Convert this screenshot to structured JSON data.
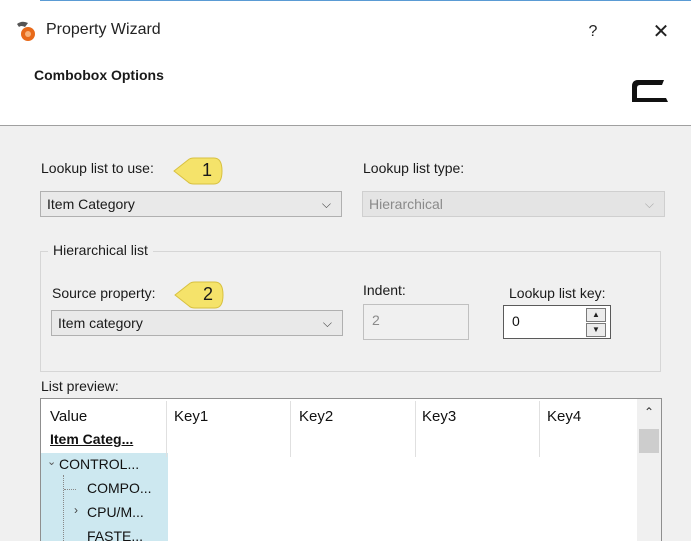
{
  "window": {
    "title": "Property Wizard",
    "help_label": "?",
    "close_label": "✕"
  },
  "header": {
    "section_title": "Combobox Options"
  },
  "lookup": {
    "list_label": "Lookup list to use:",
    "list_value": "Item Category",
    "type_label": "Lookup list type:",
    "type_value": "Hierarchical"
  },
  "callouts": [
    "1",
    "2"
  ],
  "hierarchical": {
    "group_label": "Hierarchical list",
    "source_label": "Source property:",
    "source_value": "Item category",
    "indent_label": "Indent:",
    "indent_value": "2",
    "key_label": "Lookup list key:",
    "key_value": "0"
  },
  "preview": {
    "label": "List preview:",
    "columns": [
      "Value",
      "Key1",
      "Key2",
      "Key3",
      "Key4"
    ],
    "rows": [
      "Item Categ...",
      "CONTROL...",
      "COMPO...",
      "CPU/M...",
      "FASTE..."
    ]
  },
  "colors": {
    "callout_fill": "#f5e36a",
    "selection": "#cde8f0",
    "brand_accent": "#e86a1a"
  }
}
